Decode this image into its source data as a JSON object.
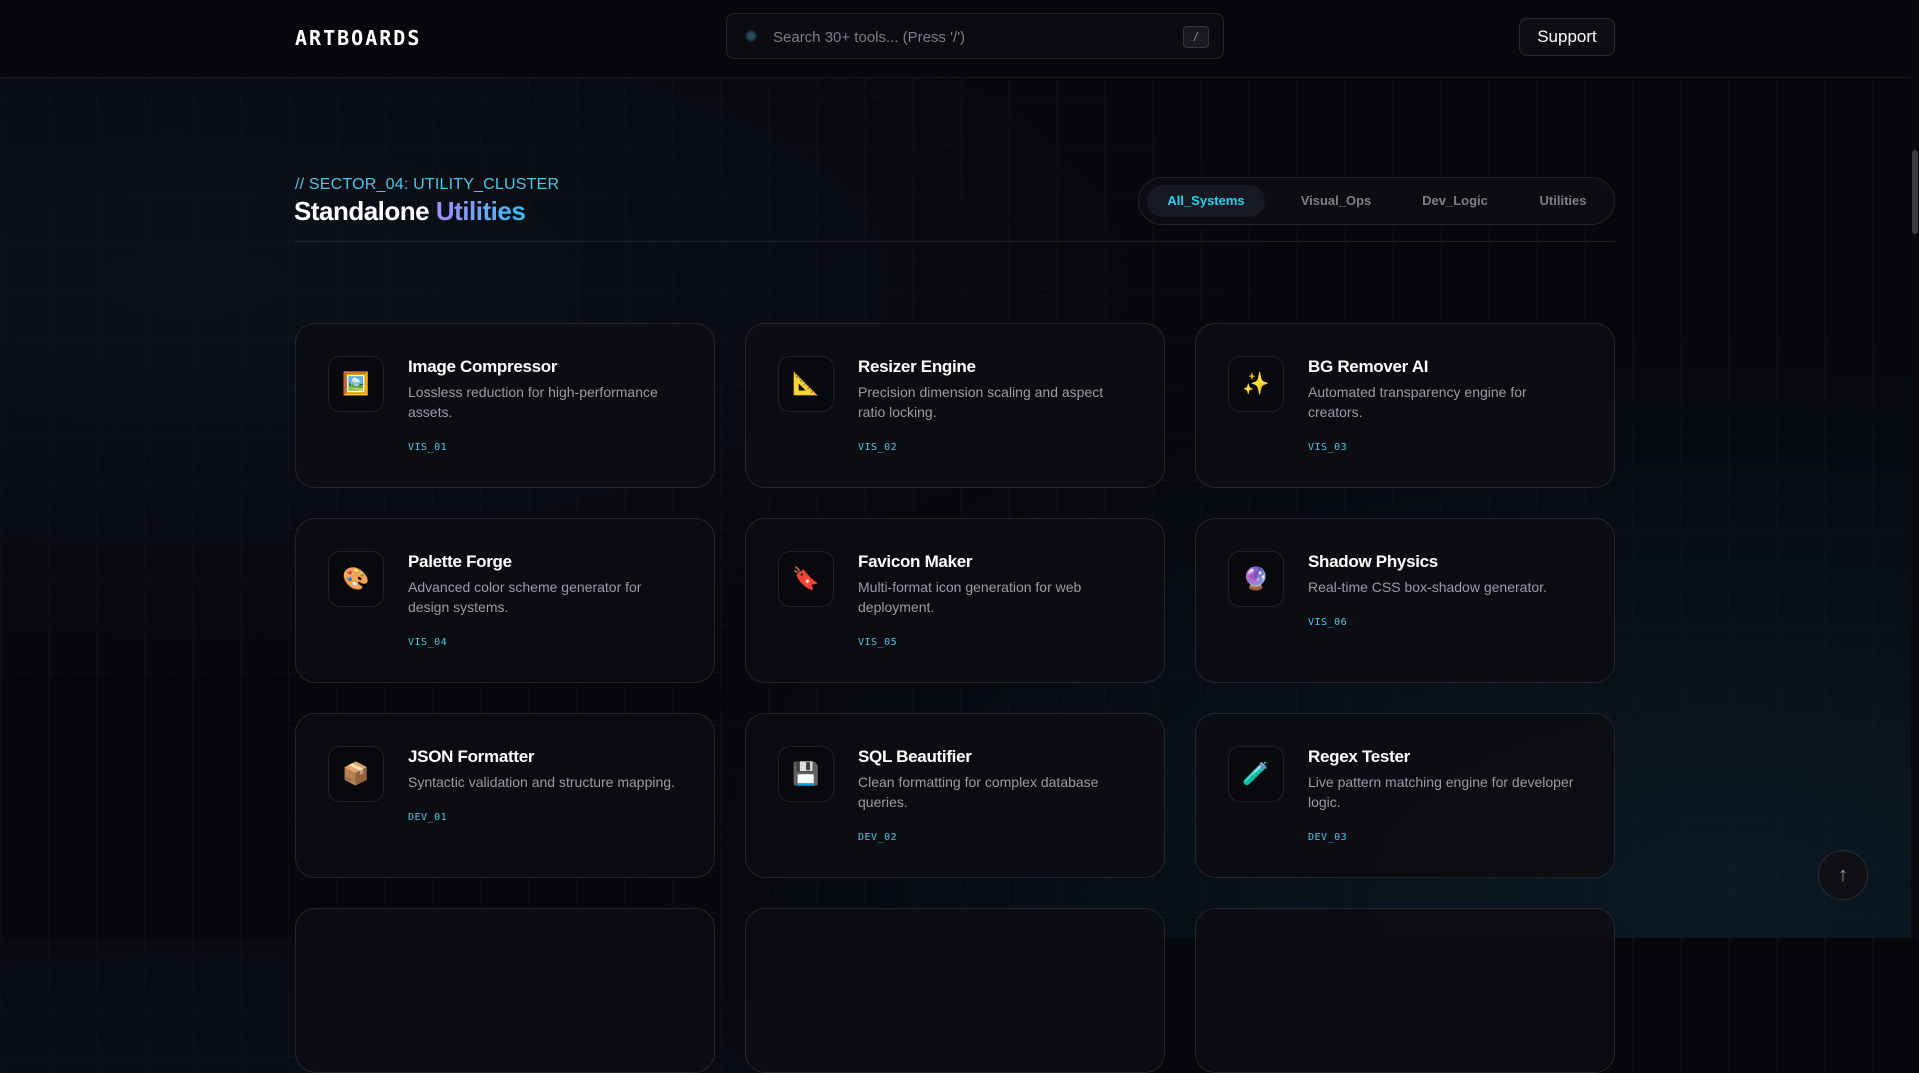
{
  "header": {
    "logo": "ARTBOARDS",
    "search_placeholder": "Search 30+ tools... (Press '/')",
    "search_shortcut": "/",
    "support_label": "Support"
  },
  "section": {
    "eyebrow": "// SECTOR_04: UTILITY_CLUSTER",
    "title_main": "Standalone",
    "title_accent": "Utilities"
  },
  "filters": [
    {
      "label": "All_Systems",
      "active": true
    },
    {
      "label": "Visual_Ops",
      "active": false
    },
    {
      "label": "Dev_Logic",
      "active": false
    },
    {
      "label": "Utilities",
      "active": false
    }
  ],
  "tools": [
    {
      "icon": "🖼️",
      "icon_name": "framed-picture-icon",
      "title": "Image Compressor",
      "desc": "Lossless reduction for high-performance assets.",
      "code": "VIS_01"
    },
    {
      "icon": "📐",
      "icon_name": "triangular-ruler-icon",
      "title": "Resizer Engine",
      "desc": "Precision dimension scaling and aspect ratio locking.",
      "code": "VIS_02"
    },
    {
      "icon": "✨",
      "icon_name": "sparkles-icon",
      "title": "BG Remover AI",
      "desc": "Automated transparency engine for creators.",
      "code": "VIS_03"
    },
    {
      "icon": "🎨",
      "icon_name": "palette-icon",
      "title": "Palette Forge",
      "desc": "Advanced color scheme generator for design systems.",
      "code": "VIS_04"
    },
    {
      "icon": "🔖",
      "icon_name": "bookmark-tag-icon",
      "title": "Favicon Maker",
      "desc": "Multi-format icon generation for web deployment.",
      "code": "VIS_05"
    },
    {
      "icon": "🔮",
      "icon_name": "crystal-ball-icon",
      "title": "Shadow Physics",
      "desc": "Real-time CSS box-shadow generator.",
      "code": "VIS_06"
    },
    {
      "icon": "📦",
      "icon_name": "package-icon",
      "title": "JSON Formatter",
      "desc": "Syntactic validation and structure mapping.",
      "code": "DEV_01"
    },
    {
      "icon": "💾",
      "icon_name": "floppy-disk-icon",
      "title": "SQL Beautifier",
      "desc": "Clean formatting for complex database queries.",
      "code": "DEV_02"
    },
    {
      "icon": "🧪",
      "icon_name": "test-tube-icon",
      "title": "Regex Tester",
      "desc": "Live pattern matching engine for developer logic.",
      "code": "DEV_03"
    }
  ],
  "scroll_top_icon": "↑"
}
